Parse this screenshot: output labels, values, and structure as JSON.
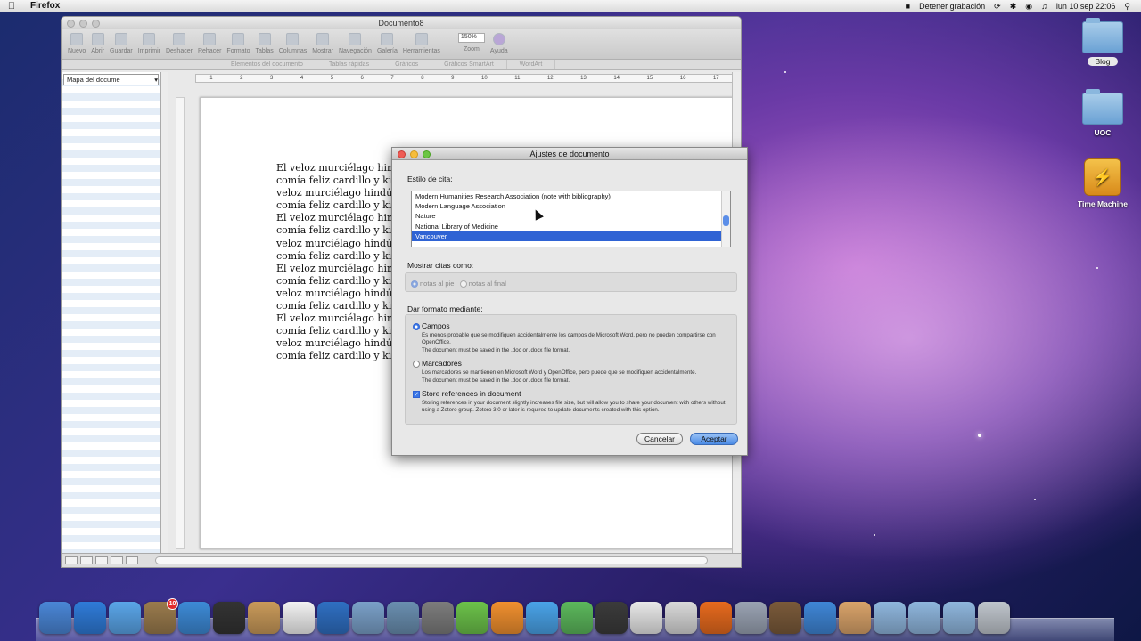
{
  "menubar": {
    "app_name": "Firefox",
    "recording": "Detener grabación",
    "clock": "lun 10 sep  22:06"
  },
  "word_window": {
    "title": "Documento8",
    "toolbar": {
      "items": [
        {
          "label": "Nuevo",
          "icon": "new-doc-icon"
        },
        {
          "label": "Abrir",
          "icon": "open-icon"
        },
        {
          "label": "Guardar",
          "icon": "save-icon"
        },
        {
          "label": "Imprimir",
          "icon": "print-icon"
        },
        {
          "label": "Deshacer",
          "icon": "undo-icon"
        },
        {
          "label": "Rehacer",
          "icon": "redo-icon"
        },
        {
          "label": "Formato",
          "icon": "format-brush-icon"
        },
        {
          "label": "Tablas",
          "icon": "table-icon"
        },
        {
          "label": "Columnas",
          "icon": "columns-icon"
        },
        {
          "label": "Mostrar",
          "icon": "pilcrow-icon"
        },
        {
          "label": "Navegación",
          "icon": "navigation-icon"
        },
        {
          "label": "Galería",
          "icon": "gallery-icon"
        },
        {
          "label": "Herramientas",
          "icon": "toolbox-icon"
        }
      ],
      "zoom_value": "150%",
      "zoom_label": "Zoom",
      "help_label": "Ayuda"
    },
    "ribbon_tabs": [
      "Elementos del documento",
      "Tablas rápidas",
      "Gráficos",
      "Gráficos SmartArt",
      "WordArt"
    ],
    "docmap_select": "Mapa del docume",
    "ruler_numbers": [
      "1",
      "2",
      "3",
      "4",
      "5",
      "6",
      "7",
      "8",
      "9",
      "10",
      "11",
      "12",
      "13",
      "14",
      "15",
      "16",
      "17"
    ],
    "doc_lines": [
      "El veloz murciélago hindú",
      "comía feliz cardillo y kiwi",
      "veloz murciélago hindú co",
      "comía feliz cardillo y kiwi",
      "El veloz murciélago hindú",
      "comía feliz cardillo y kiwi",
      "veloz murciélago hindú co",
      "comía feliz cardillo y kiwi",
      "El veloz murciélago hindú",
      "comía feliz cardillo y kiwi",
      "veloz murciélago hindú co",
      "comía feliz cardillo y kiwi",
      "El veloz murciélago hindú",
      "comía feliz cardillo y kiwi",
      "veloz murciélago hindú co",
      "comía feliz cardillo y kiwi"
    ]
  },
  "dialog": {
    "title": "Ajustes de documento",
    "citation_style_label": "Estilo de cita:",
    "styles": [
      "Modern Humanities Research Association (note with bibliography)",
      "Modern Language Association",
      "Nature",
      "National Library of Medicine",
      "Vancouver"
    ],
    "selected_style": "Vancouver",
    "show_citations_label": "Mostrar citas como:",
    "show_options": [
      "notas al pie",
      "notas al final"
    ],
    "format_label": "Dar formato mediante:",
    "fields_label": "Campos",
    "fields_desc_1": "Es menos probable que se modifiquen accidentalmente los campos de Microsoft Word, pero no pueden compartirse con OpenOffice.",
    "fields_desc_2": "The document must be saved in the .doc or .docx file format.",
    "bookmarks_label": "Marcadores",
    "bookmarks_desc_1": "Los marcadores se mantienen en Microsoft Word y OpenOffice, pero puede que se modifiquen accidentalmente.",
    "bookmarks_desc_2": "The document must be saved in the .doc or .docx file format.",
    "store_label": "Store references in document",
    "store_desc": "Storing references in your document slightly increases file size, but will allow you to share your document with others without using a Zotero group. Zotero 3.0 or later is required to update documents created with this option.",
    "cancel": "Cancelar",
    "accept": "Aceptar"
  },
  "desktop": {
    "icons": [
      {
        "label": "Blog",
        "type": "folder"
      },
      {
        "label": "UOC",
        "type": "folder"
      },
      {
        "label": "Time Machine",
        "type": "drive"
      }
    ]
  },
  "dock": {
    "items": [
      {
        "name": "finder-icon",
        "color": "#4a86d6"
      },
      {
        "name": "app-store-icon",
        "color": "#2f7bd8"
      },
      {
        "name": "ichat-icon",
        "color": "#5aa5e8"
      },
      {
        "name": "mail-stamp-icon",
        "color": "#9a7b4d",
        "badge": "10"
      },
      {
        "name": "safari-icon",
        "color": "#3d8ad6"
      },
      {
        "name": "dashboard-icon",
        "color": "#333333"
      },
      {
        "name": "address-book-icon",
        "color": "#c99a5a"
      },
      {
        "name": "ical-icon",
        "color": "#f2f2f2"
      },
      {
        "name": "itunes-icon",
        "color": "#2f6fc2"
      },
      {
        "name": "preview-icon",
        "color": "#7aa0c8"
      },
      {
        "name": "iphoto-icon",
        "color": "#6a8fb0"
      },
      {
        "name": "system-prefs-icon",
        "color": "#7c7c7c"
      },
      {
        "name": "office-excel-icon",
        "color": "#6cc24a"
      },
      {
        "name": "office-powerpoint-icon",
        "color": "#f0902f"
      },
      {
        "name": "office-word-icon",
        "color": "#4aa3e8"
      },
      {
        "name": "messenger-icon",
        "color": "#5cb85c"
      },
      {
        "name": "facetime-icon",
        "color": "#3b3b3b"
      },
      {
        "name": "calendar-icon",
        "color": "#e8e8e8"
      },
      {
        "name": "scissors-icon",
        "color": "#d9d9d9"
      },
      {
        "name": "firefox-icon",
        "color": "#e66a1e"
      },
      {
        "name": "script-editor-icon",
        "color": "#9aa3b3"
      },
      {
        "name": "keynote-icon",
        "color": "#7a5a3a"
      },
      {
        "name": "quicktime-icon",
        "color": "#3f86d6"
      },
      {
        "name": "home-folder-icon",
        "color": "#d9a36a"
      },
      {
        "name": "applications-folder-icon",
        "color": "#8fb6dd"
      },
      {
        "name": "documents-folder-icon",
        "color": "#8fb6dd"
      },
      {
        "name": "downloads-folder-icon",
        "color": "#8fb6dd"
      },
      {
        "name": "trash-icon",
        "color": "#bfc5cc"
      }
    ]
  }
}
